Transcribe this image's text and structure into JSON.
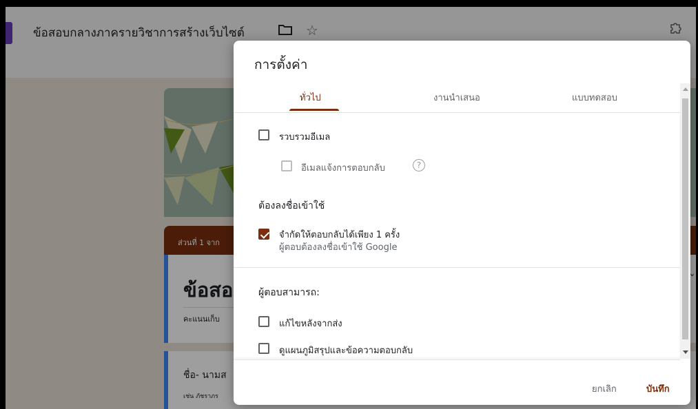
{
  "app": {
    "doc_title": "ข้อสอบกลางภาครายวิชาการสร้างเว็บไซต์",
    "icons": [
      "form-icon",
      "folder-icon",
      "star-icon",
      "addon-icon"
    ]
  },
  "background_form": {
    "section_tag": "ส่วนที่ 1 จาก",
    "card1_title": "ข้อสอ",
    "card1_sub": "คะแนนเก็บ",
    "card2_title": "ชื่อ- นามส",
    "card2_sub": "เช่น ภัชราภร",
    "accent_color": "#7a2f0f",
    "card_border_color": "#4285f4"
  },
  "dialog": {
    "title": "การตั้งค่า",
    "tabs": [
      {
        "label": "ทั่วไป",
        "active": true
      },
      {
        "label": "งานนำเสนอ",
        "active": false
      },
      {
        "label": "แบบทดสอบ",
        "active": false
      }
    ],
    "collect_email": {
      "label": "รวบรวมอีเมล",
      "checked": false
    },
    "email_receipt": {
      "label": "อีเมลแจ้งการตอบกลับ",
      "checked": false,
      "disabled": true,
      "help": "?"
    },
    "signin_heading": "ต้องลงชื่อเข้าใช้",
    "limit_one": {
      "label": "จำกัดให้ตอบกลับได้เพียง 1 ครั้ง",
      "sublabel": "ผู้ตอบต้องลงชื่อเข้าใช้ Google",
      "checked": true
    },
    "respondents_heading": "ผู้ตอบสามารถ:",
    "edit_after": {
      "label": "แก้ไขหลังจากส่ง",
      "checked": false
    },
    "see_summary": {
      "label": "ดูแผนภูมิสรุปและข้อความตอบกลับ",
      "checked": false
    },
    "cancel_label": "ยกเลิก",
    "save_label": "บันทึก"
  }
}
